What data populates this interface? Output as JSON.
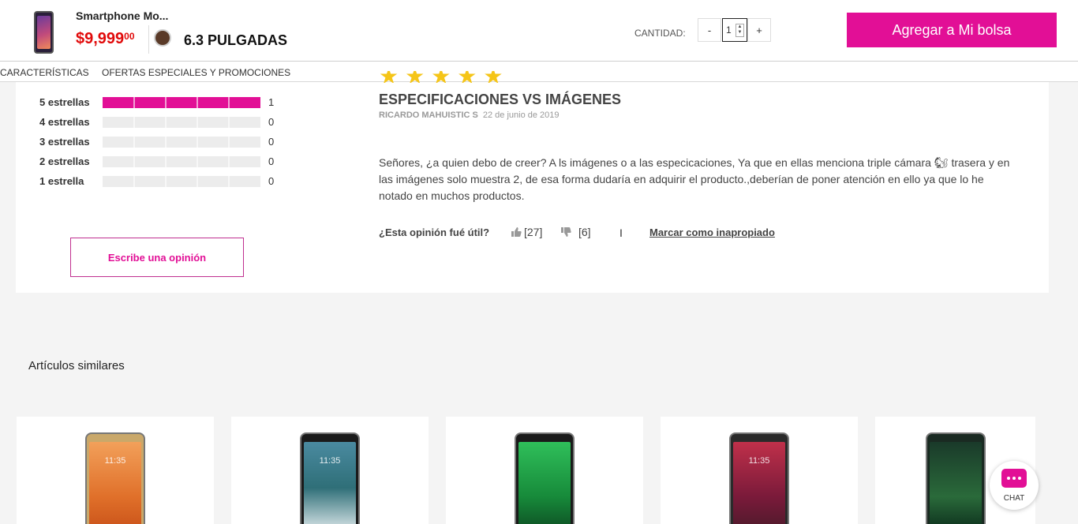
{
  "header": {
    "product_name": "Smartphone Mo...",
    "price_main": "$9,999",
    "price_cents": "00",
    "screen_size": "6.3 PULGADAS",
    "quantity_label": "CANTIDAD:",
    "qty_minus": "-",
    "qty_value": "1",
    "qty_plus": "+",
    "spin_up": "▲",
    "spin_down": "▼",
    "add_button": "Agregar a Mi bolsa",
    "swatch_color": "#5a3a28"
  },
  "tabs": [
    "CARACTERÍSTICAS",
    "OFERTAS ESPECIALES Y PROMOCIONES"
  ],
  "ratings": {
    "rows": [
      {
        "label": "5 estrellas",
        "count": "1",
        "fraction": 1.0
      },
      {
        "label": "4 estrellas",
        "count": "0",
        "fraction": 0
      },
      {
        "label": "3 estrellas",
        "count": "0",
        "fraction": 0
      },
      {
        "label": "2 estrellas",
        "count": "0",
        "fraction": 0
      },
      {
        "label": "1 estrella",
        "count": "0",
        "fraction": 0
      }
    ],
    "write_button": "Escribe una opinión",
    "stars_shown": 5
  },
  "review": {
    "title": "ESPECIFICACIONES VS IMÁGENES",
    "author": "RICARDO MAHUISTIC S",
    "date": "22 de junio de 2019",
    "body": "Señores, ¿a quien debo de creer? A ls imágenes o a las especicaciones, Ya que en ellas menciona triple cámara 🐿 trasera y en las imágenes solo muestra 2, de esa forma dudaría en adquirir el producto.,deberían de poner atención en ello ya que lo he notado en muchos productos.",
    "useful_question": "¿Esta opinión fué útil?",
    "likes": "[27]",
    "dislikes": "[6]",
    "separator": "I",
    "report_link": "Marcar como inapropiado"
  },
  "similar": {
    "title": "Artículos similares",
    "items": [
      {
        "icon": "phone-gold-icon",
        "screen": "linear-gradient(180deg,#f2a05a,#e0702a 60%,#c85018)",
        "frame": "#c9a86a",
        "clock": "11:35"
      },
      {
        "icon": "phone-black-icon",
        "screen": "linear-gradient(180deg,#4a8aa0,#2f6f78 50%,#e6eef0)",
        "frame": "#1a1a1a",
        "clock": "11:35"
      },
      {
        "icon": "phone-dark-icon",
        "screen": "linear-gradient(180deg,#2fbf5a,#178a3a 60%,#0d4a22)",
        "frame": "#1a1a1a",
        "clock": ""
      },
      {
        "icon": "phone-red-icon",
        "screen": "linear-gradient(180deg,#c0304a,#7a1a3a 60%,#4a1a2a)",
        "frame": "#2a2a2a",
        "clock": "11:35"
      },
      {
        "icon": "phone-green-icon",
        "screen": "linear-gradient(180deg,#1a3a2a,#2a6a3a 60%,#0a2a1a)",
        "frame": "#1a2a22",
        "clock": ""
      }
    ]
  },
  "chat": {
    "label": "CHAT"
  },
  "colors": {
    "accent": "#e20f96",
    "price": "#e10a0a",
    "star": "#f5c518"
  }
}
